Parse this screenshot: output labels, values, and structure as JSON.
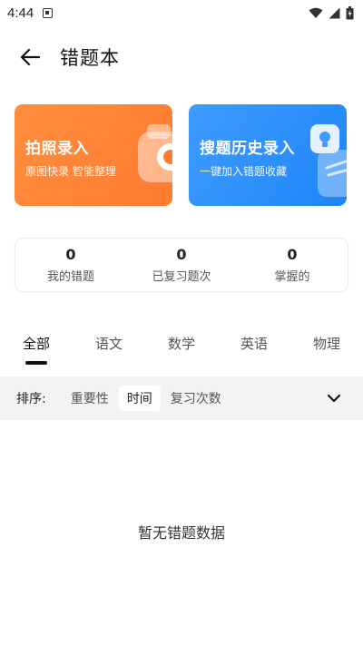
{
  "status_bar": {
    "time": "4:44"
  },
  "header": {
    "title": "错题本"
  },
  "entry_cards": [
    {
      "title": "拍照录入",
      "subtitle": "原图快录 智能整理",
      "color": "#ff8439"
    },
    {
      "title": "搜题历史录入",
      "subtitle": "一键加入错题收藏",
      "color": "#2f8ff9"
    }
  ],
  "stats": [
    {
      "value": "0",
      "label": "我的错题"
    },
    {
      "value": "0",
      "label": "已复习题次"
    },
    {
      "value": "0",
      "label": "掌握的"
    }
  ],
  "tabs": [
    {
      "label": "全部",
      "active": true
    },
    {
      "label": "语文"
    },
    {
      "label": "数学"
    },
    {
      "label": "英语"
    },
    {
      "label": "物理"
    }
  ],
  "sort": {
    "label": "排序:",
    "options": [
      {
        "label": "重要性"
      },
      {
        "label": "时间",
        "active": true
      },
      {
        "label": "复习次数"
      }
    ]
  },
  "empty_state": {
    "text": "暂无错题数据"
  }
}
